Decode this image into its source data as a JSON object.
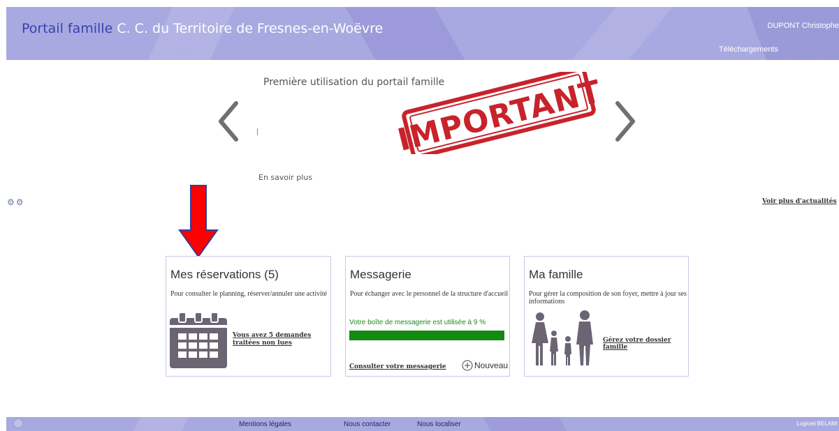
{
  "header": {
    "brand_accent": "Portail famille",
    "brand_rest": " C. C. du Territoire de Fresnes-en-Woëvre",
    "user_name": "DUPONT Christophe",
    "downloads_label": "Téléchargements"
  },
  "carousel": {
    "title": "Première utilisation du portail famille",
    "stamp_text": "IMPORTANT",
    "more_label": "En savoir plus",
    "prev_icon": "chevron-left-icon",
    "next_icon": "chevron-right-icon"
  },
  "news": {
    "more_label": "Voir plus d'actualités"
  },
  "tiles": {
    "reservations": {
      "title": "Mes réservations (5)",
      "description": "Pour consulter le planning, réserver/annuler une activité",
      "link": "Vous avez 5 demandes traitées non lues",
      "icon": "calendar-icon"
    },
    "messaging": {
      "title": "Messagerie",
      "description": "Pour échanger avec le personnel de la structure d'accueil",
      "usage_text": "Votre boîte de messagerie est utilisée à 9 %",
      "usage_percent": 9,
      "link": "Consulter votre messagerie",
      "new_label": "Nouveau",
      "new_icon": "plus-circle-icon"
    },
    "family": {
      "title": "Ma famille",
      "description": "Pour gérer la composition de son foyer, mettre à jour ses informations",
      "link": "Gérez votre dossier famille",
      "icon": "family-icon"
    }
  },
  "footer": {
    "legal": "Mentions légales",
    "contact": "Nous contacter",
    "locate": "Nous localiser",
    "credit": "Logiciel BELAMI"
  },
  "colors": {
    "header_bg": "#a8a9e0",
    "brand_accent": "#3a3fb0",
    "progress_fill": "#138a12",
    "annotation_arrow": "#ff0000",
    "stamp": "#c8232b"
  }
}
